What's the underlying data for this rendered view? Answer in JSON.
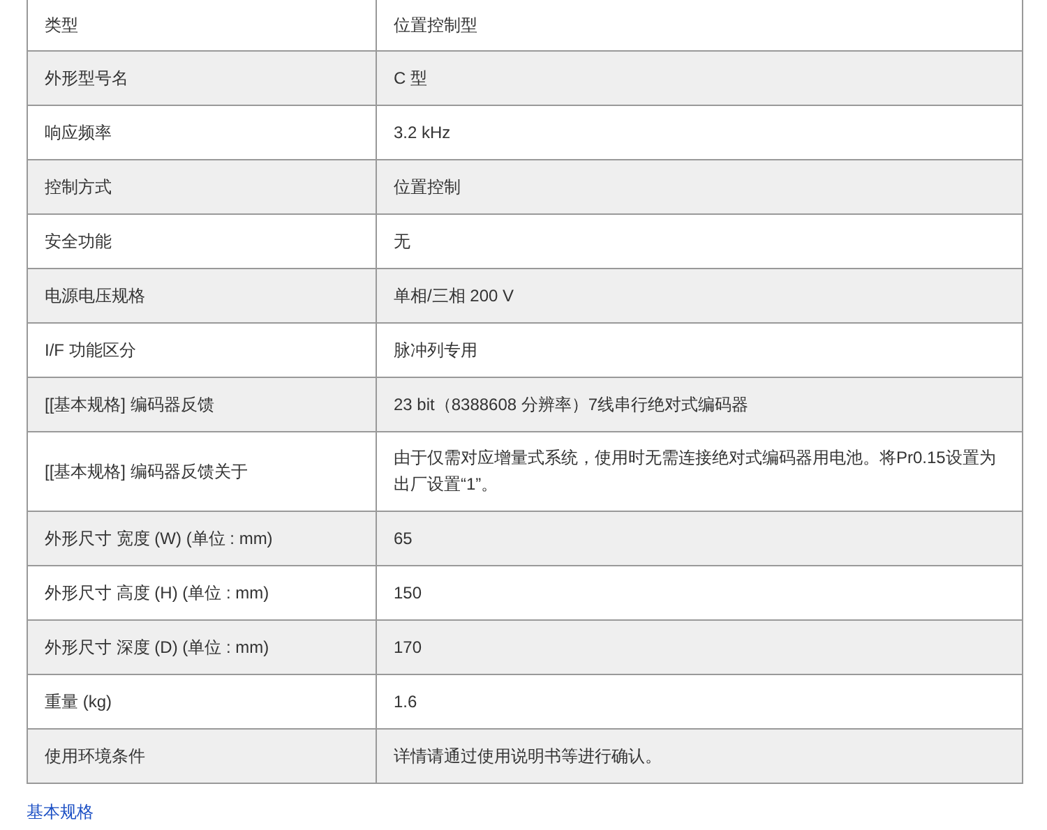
{
  "spec_table": {
    "rows": [
      {
        "label": "类型",
        "value": "位置控制型"
      },
      {
        "label": "外形型号名",
        "value": "C 型"
      },
      {
        "label": "响应频率",
        "value": "3.2 kHz"
      },
      {
        "label": "控制方式",
        "value": "位置控制"
      },
      {
        "label": "安全功能",
        "value": "无"
      },
      {
        "label": "电源电压规格",
        "value": "单相/三相 200 V"
      },
      {
        "label": "I/F 功能区分",
        "value": "脉冲列专用"
      },
      {
        "label": "[[基本规格] 编码器反馈",
        "value": "23 bit（8388608 分辨率）7线串行绝对式编码器"
      },
      {
        "label": "[[基本规格] 编码器反馈关于",
        "value": "由于仅需对应增量式系统，使用时无需连接绝对式编码器用电池。将Pr0.15设置为出厂设置“1”。"
      },
      {
        "label": "外形尺寸 宽度 (W) (单位 : mm)",
        "value": "65"
      },
      {
        "label": "外形尺寸 高度 (H) (单位 : mm)",
        "value": "150"
      },
      {
        "label": "外形尺寸 深度 (D) (单位 : mm)",
        "value": "170"
      },
      {
        "label": "重量 (kg)",
        "value": "1.6"
      },
      {
        "label": "使用环境条件",
        "value": "详情请通过使用说明书等进行确认。"
      }
    ]
  },
  "section_link": "基本规格"
}
